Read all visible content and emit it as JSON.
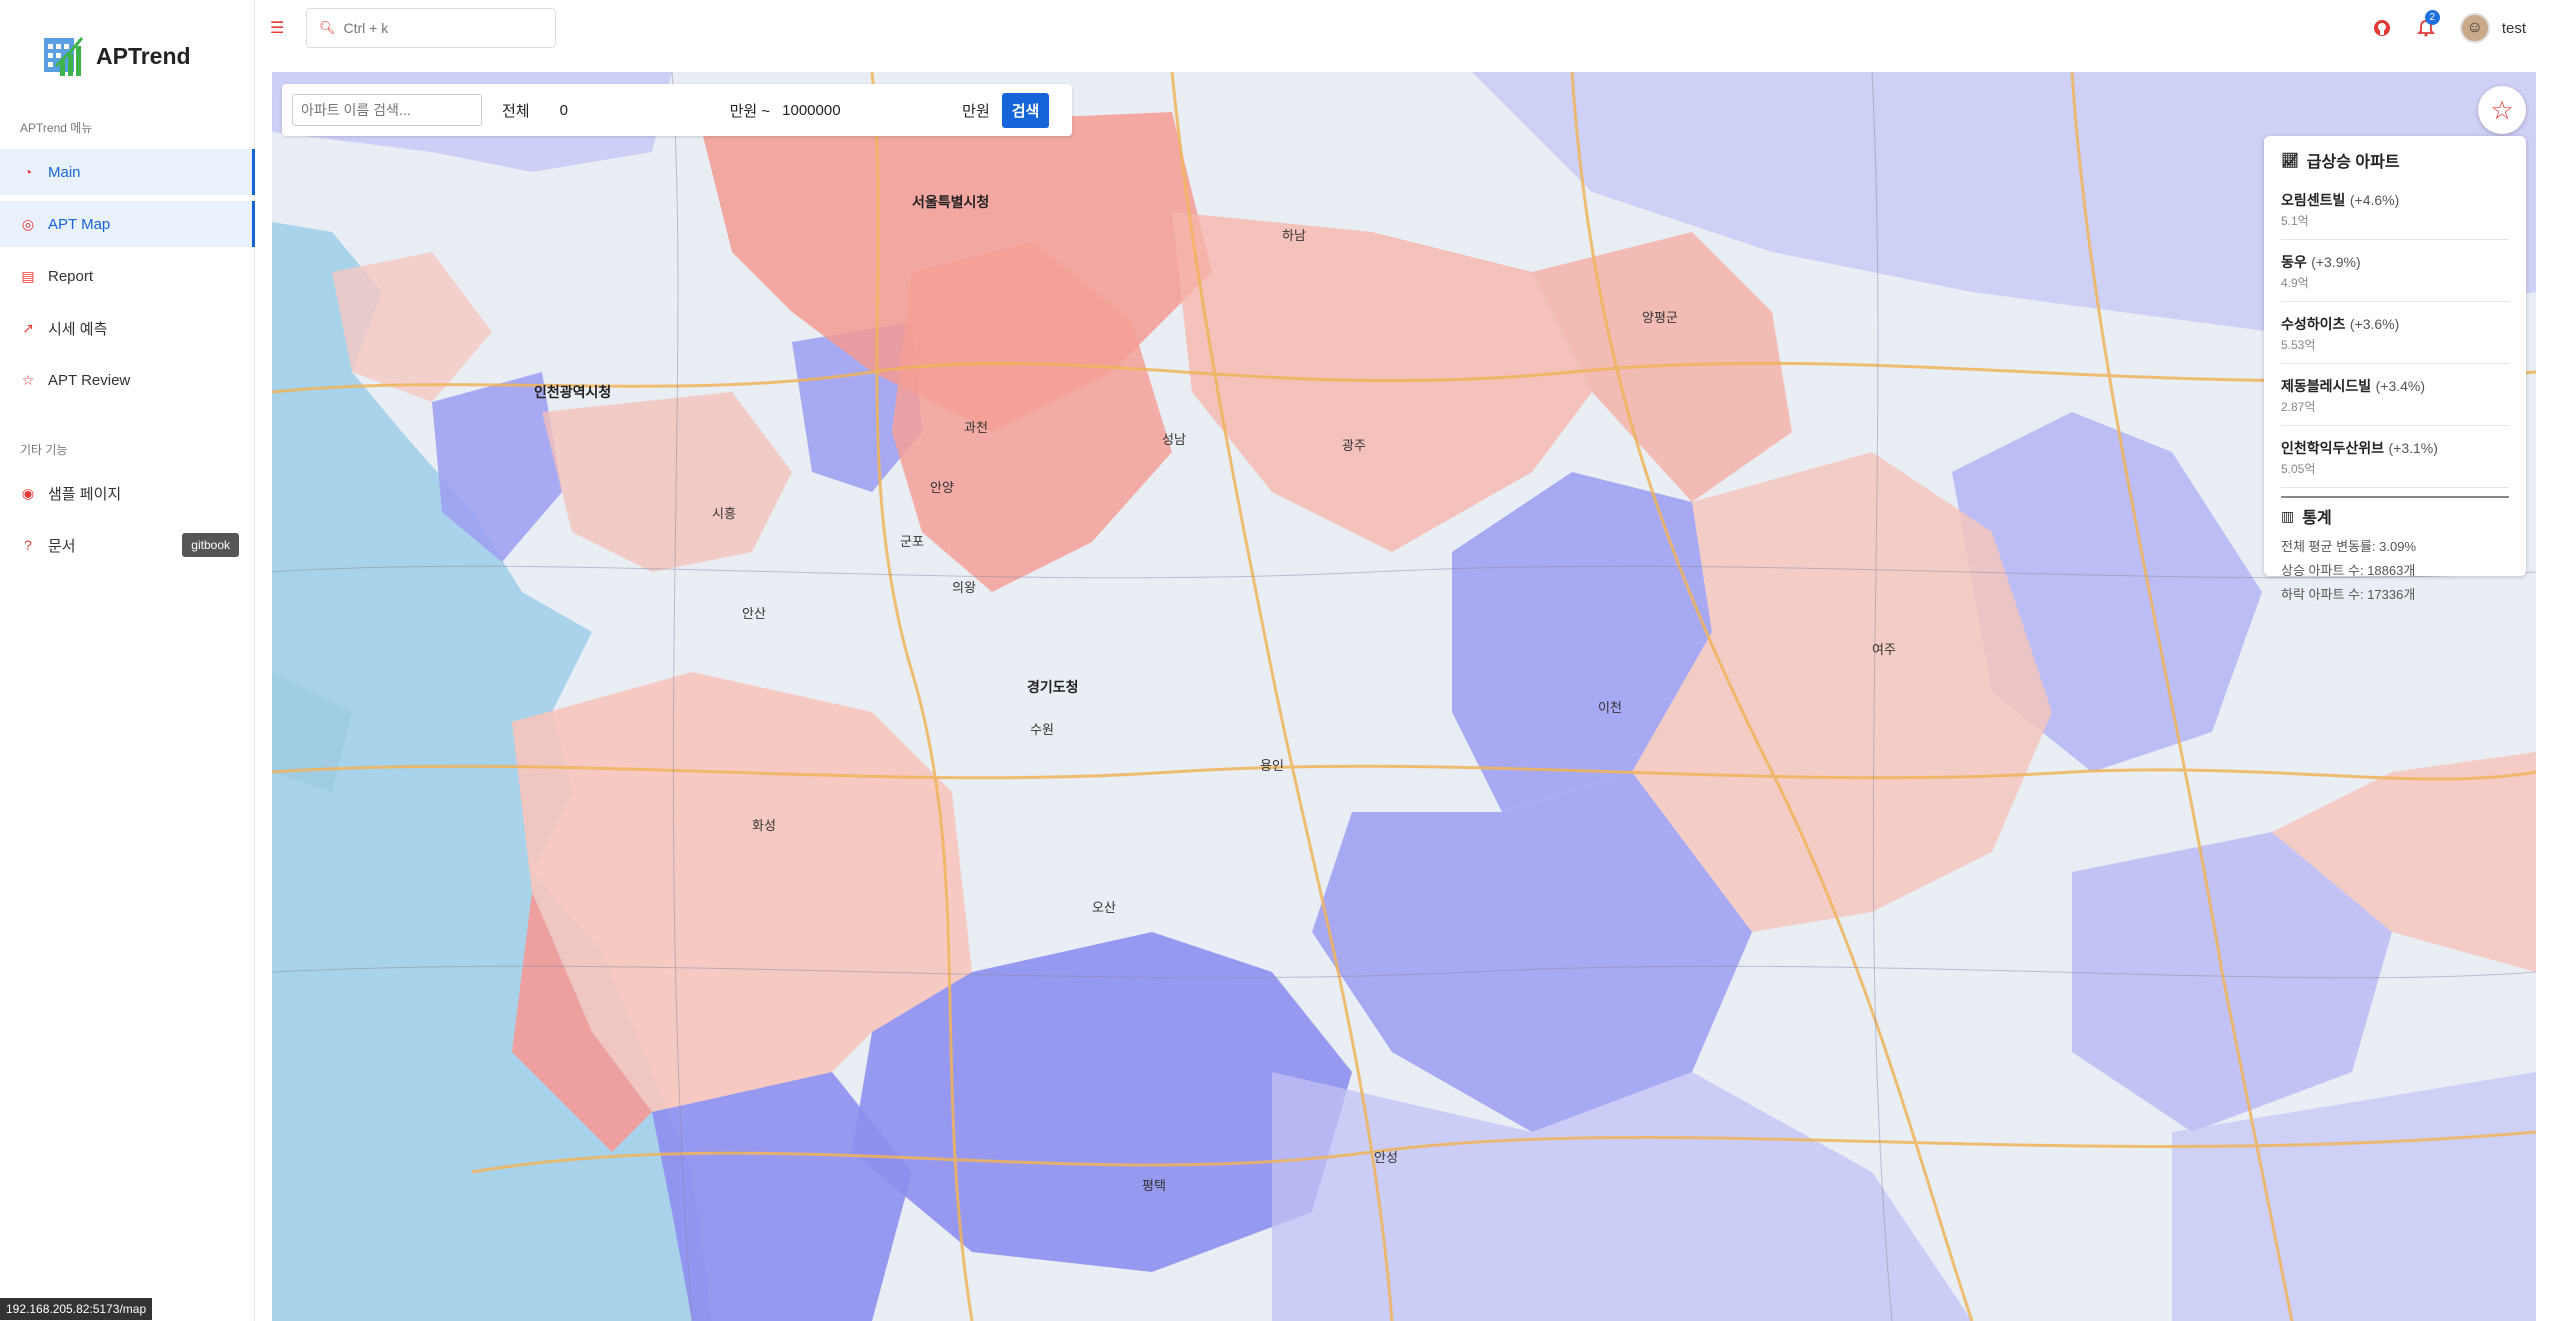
{
  "brand": {
    "name": "APTrend"
  },
  "sidebar": {
    "section_main": "APTrend 메뉴",
    "items": [
      {
        "label": "Main",
        "icon": "dashboard-icon",
        "active": true
      },
      {
        "label": "APT Map",
        "icon": "map-pin-icon",
        "active": true
      },
      {
        "label": "Report",
        "icon": "document-icon",
        "active": false
      },
      {
        "label": "시세 예측",
        "icon": "chart-line-icon",
        "active": false
      },
      {
        "label": "APT Review",
        "icon": "star-icon",
        "active": false
      }
    ],
    "section_other": "기타 기능",
    "other_items": [
      {
        "label": "샘플 페이지",
        "icon": "target-icon"
      },
      {
        "label": "문서",
        "icon": "question-icon",
        "badge": "gitbook"
      }
    ]
  },
  "topbar": {
    "search_placeholder": "Ctrl + k",
    "notification_count": "2",
    "username": "test"
  },
  "filter": {
    "apt_placeholder": "아파트 이름 검색...",
    "region": "전체",
    "min_price": "0",
    "unit_tilde": "만원 ~",
    "max_price": "1000000",
    "unit": "만원",
    "search_label": "검색"
  },
  "rising_panel": {
    "title": "급상승 아파트",
    "items": [
      {
        "name": "오림센트빌",
        "rate": "(+4.6%)",
        "price": "5.1억"
      },
      {
        "name": "동우",
        "rate": "(+3.9%)",
        "price": "4.9억"
      },
      {
        "name": "수성하이츠",
        "rate": "(+3.6%)",
        "price": "5.53억"
      },
      {
        "name": "제동블레시드빌",
        "rate": "(+3.4%)",
        "price": "2.87억"
      },
      {
        "name": "인천학익두산위브",
        "rate": "(+3.1%)",
        "price": "5.05억"
      }
    ],
    "stats_title": "통계",
    "stats": [
      "전체 평균 변동률: 3.09%",
      "상승 아파트 수: 18863개",
      "하락 아파트 수: 17336개"
    ]
  },
  "map_labels": [
    "서울특별시청",
    "인천광역시청",
    "경기도청",
    "과천",
    "안양",
    "수원",
    "화성",
    "오산",
    "평택",
    "안성",
    "용인",
    "이천",
    "광주",
    "하남",
    "시흥",
    "군포",
    "의왕",
    "성남",
    "여주",
    "양평군",
    "안산"
  ],
  "status_url": "192.168.205.82:5173/map",
  "colors": {
    "accent": "#1565d8",
    "icon": "#e53935",
    "rise": "#f28b82",
    "fall": "#8c8cf0"
  }
}
